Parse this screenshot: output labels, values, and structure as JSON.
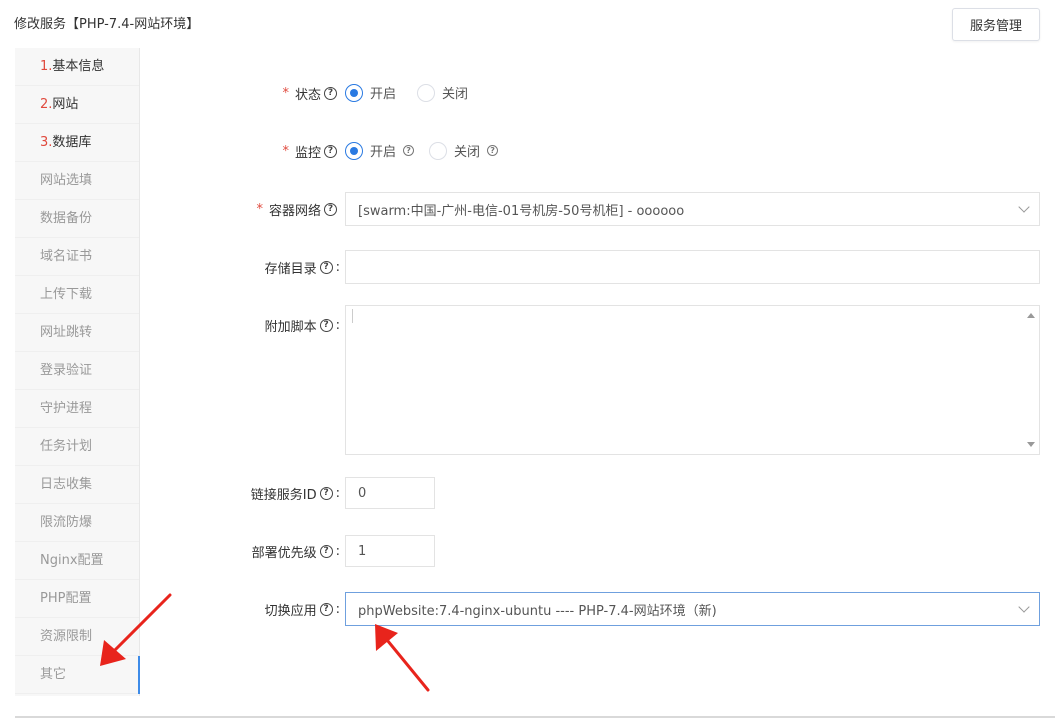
{
  "header": {
    "title": "修改服务【PHP-7.4-网站环境】",
    "service_manage_button": "服务管理"
  },
  "sidebar": {
    "items": [
      {
        "num": "1.",
        "label": "基本信息"
      },
      {
        "num": "2.",
        "label": "网站"
      },
      {
        "num": "3.",
        "label": "数据库"
      },
      {
        "num": "",
        "label": "网站选填"
      },
      {
        "num": "",
        "label": "数据备份"
      },
      {
        "num": "",
        "label": "域名证书"
      },
      {
        "num": "",
        "label": "上传下载"
      },
      {
        "num": "",
        "label": "网址跳转"
      },
      {
        "num": "",
        "label": "登录验证"
      },
      {
        "num": "",
        "label": "守护进程"
      },
      {
        "num": "",
        "label": "任务计划"
      },
      {
        "num": "",
        "label": "日志收集"
      },
      {
        "num": "",
        "label": "限流防爆"
      },
      {
        "num": "",
        "label": "Nginx配置"
      },
      {
        "num": "",
        "label": "PHP配置"
      },
      {
        "num": "",
        "label": "资源限制"
      },
      {
        "num": "",
        "label": "其它"
      }
    ],
    "active": "其它"
  },
  "form": {
    "status": {
      "label": "状态",
      "required": "*",
      "on": "开启",
      "off": "关闭",
      "selected": "开启"
    },
    "monitor": {
      "label": "监控",
      "required": "*",
      "on": "开启",
      "off": "关闭",
      "selected": "开启"
    },
    "network": {
      "label": "容器网络",
      "required": "*",
      "value": "[swarm:中国-广州-电信-01号机房-50号机柜] - oooooo"
    },
    "storage": {
      "label": "存储目录",
      "colon": ":",
      "value": ""
    },
    "script": {
      "label": "附加脚本",
      "colon": ":",
      "value": ""
    },
    "link_service": {
      "label": "链接服务ID",
      "colon": ":",
      "value": "0"
    },
    "priority": {
      "label": "部署优先级",
      "colon": ":",
      "value": "1"
    },
    "switch_app": {
      "label": "切换应用",
      "colon": ":",
      "value": "phpWebsite:7.4-nginx-ubuntu ---- PHP-7.4-网站环境（新)"
    }
  },
  "icons": {
    "help": "question-circle-icon",
    "help_glyph": "?",
    "dropdown": "chevron-down-icon"
  },
  "colors": {
    "accent": "#2a7ae2",
    "required": "#e0493d",
    "annotation_arrow": "#e8241c"
  }
}
